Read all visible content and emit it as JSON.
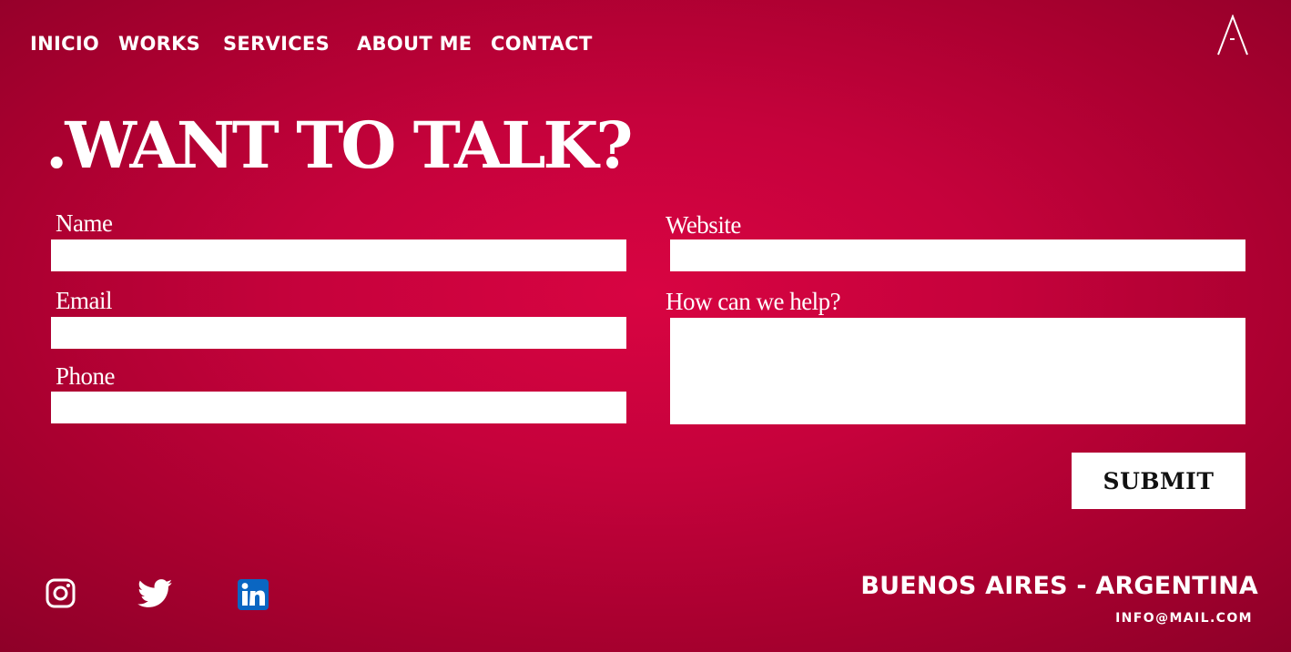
{
  "nav": {
    "items": [
      {
        "label": "INICIO"
      },
      {
        "label": "WORKS"
      },
      {
        "label": "SERVICES"
      },
      {
        "label": "ABOUT ME"
      },
      {
        "label": "CONTACT"
      }
    ]
  },
  "logo": {
    "icon": "letter-a-logo"
  },
  "page": {
    "title": ".WANT TO TALK?"
  },
  "form": {
    "name_label": "Name",
    "name_value": "",
    "email_label": "Email",
    "email_value": "",
    "phone_label": "Phone",
    "phone_value": "",
    "website_label": "Website",
    "website_value": "",
    "help_label": "How can we help?",
    "help_value": "",
    "submit_label": "SUBMIT"
  },
  "social": {
    "icons": [
      "instagram-icon",
      "twitter-icon",
      "linkedin-icon"
    ],
    "linkedin_color": "#0a66c2"
  },
  "footer": {
    "location": "BUENOS AIRES - ARGENTINA",
    "email": "INFO@MAIL.COM"
  },
  "colors": {
    "background_center": "#d80442",
    "background_edge": "#8d0028",
    "text": "#ffffff"
  }
}
